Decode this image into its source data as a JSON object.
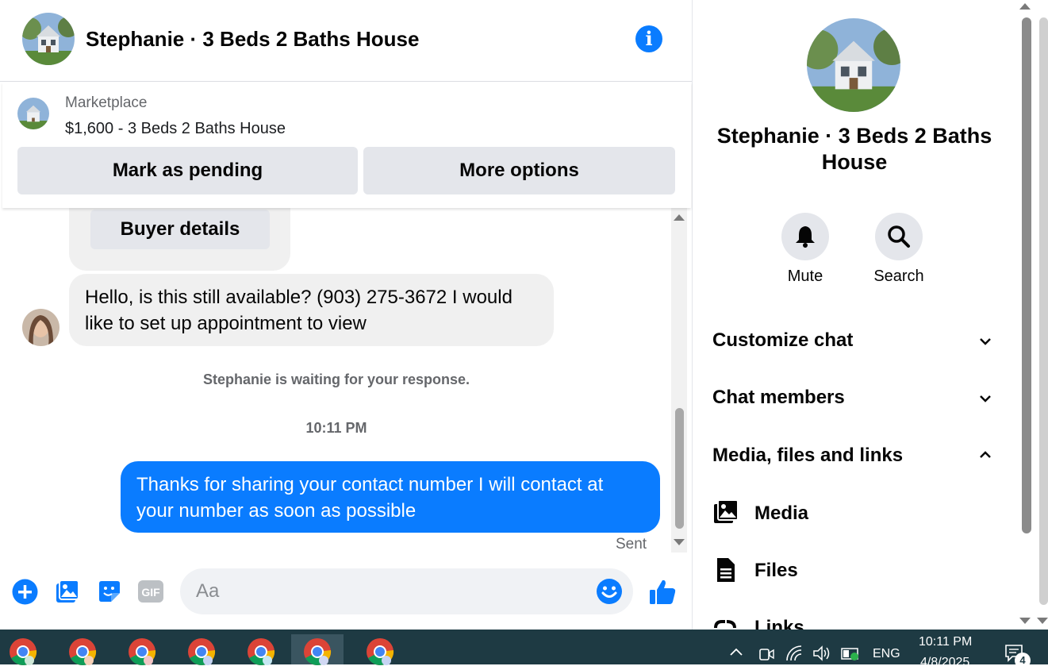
{
  "header": {
    "title": "Stephanie · 3 Beds 2 Baths House"
  },
  "marketplace": {
    "label": "Marketplace",
    "listing": "$1,600 - 3 Beds 2 Baths House",
    "mark_pending_label": "Mark as pending",
    "more_options_label": "More options"
  },
  "messages": {
    "buyer_details_label": "Buyer details",
    "incoming_text": "Hello, is this still available? (903) 275-3672 I would like to set up appointment to view",
    "waiting_notice": "Stephanie is waiting for your response.",
    "timestamp": "10:11 PM",
    "outgoing_text": "Thanks for sharing your contact number I will contact at your number as soon as possible",
    "sent_status": "Sent"
  },
  "composer": {
    "placeholder": "Aa",
    "icons": [
      "plus-icon",
      "photo-icon",
      "sticker-icon",
      "gif-icon",
      "emoji-icon",
      "like-icon"
    ],
    "gif_label": "GIF"
  },
  "right_panel": {
    "name": "Stephanie · 3 Beds 2 Baths House",
    "mute_label": "Mute",
    "search_label": "Search",
    "sections": {
      "customize": "Customize chat",
      "members": "Chat members",
      "media_files_links": "Media, files and links"
    },
    "sub_items": {
      "media": "Media",
      "files": "Files",
      "links": "Links"
    }
  },
  "taskbar": {
    "language": "ENG",
    "time": "10:11 PM",
    "date": "4/8/2025",
    "notification_count": "4"
  },
  "colors": {
    "messenger_blue": "#0a7cff",
    "bubble_gray": "#f0f0f0",
    "button_gray": "#e4e6eb",
    "taskbar": "#1e3a43"
  }
}
